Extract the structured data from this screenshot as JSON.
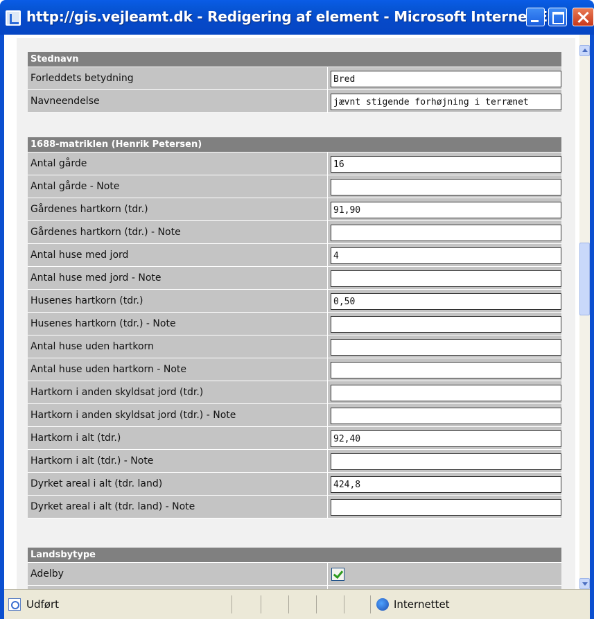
{
  "window": {
    "title": "http://gis.vejleamt.dk - Redigering af element - Microsoft Internet E..."
  },
  "sections": {
    "stednavn": {
      "header": "Stednavn",
      "rows": [
        {
          "label": "Forleddets betydning",
          "value": "Bred"
        },
        {
          "label": "Navneendelse",
          "value": "jævnt stigende forhøjning i terrænet"
        }
      ]
    },
    "matrikel": {
      "header": "1688-matriklen (Henrik Petersen)",
      "rows": [
        {
          "label": "Antal gårde",
          "value": "16"
        },
        {
          "label": "Antal gårde - Note",
          "value": ""
        },
        {
          "label": "Gårdenes hartkorn (tdr.)",
          "value": "91,90"
        },
        {
          "label": "Gårdenes hartkorn (tdr.) - Note",
          "value": ""
        },
        {
          "label": "Antal huse med jord",
          "value": "4"
        },
        {
          "label": "Antal huse med jord - Note",
          "value": ""
        },
        {
          "label": "Husenes hartkorn (tdr.)",
          "value": "0,50"
        },
        {
          "label": "Husenes hartkorn (tdr.) - Note",
          "value": ""
        },
        {
          "label": "Antal huse uden hartkorn",
          "value": ""
        },
        {
          "label": "Antal huse uden hartkorn - Note",
          "value": ""
        },
        {
          "label": "Hartkorn i anden skyldsat jord (tdr.)",
          "value": ""
        },
        {
          "label": "Hartkorn i anden skyldsat jord (tdr.) - Note",
          "value": ""
        },
        {
          "label": "Hartkorn i alt (tdr.)",
          "value": "92,40"
        },
        {
          "label": "Hartkorn i alt (tdr.) - Note",
          "value": ""
        },
        {
          "label": "Dyrket areal i alt (tdr. land)",
          "value": "424,8"
        },
        {
          "label": "Dyrket areal i alt (tdr. land) - Note",
          "value": ""
        }
      ]
    },
    "landsbytype": {
      "header": "Landsbytype",
      "rows": [
        {
          "label": "Adelby",
          "checked": true
        }
      ]
    }
  },
  "statusbar": {
    "status": "Udført",
    "zone": "Internettet"
  }
}
